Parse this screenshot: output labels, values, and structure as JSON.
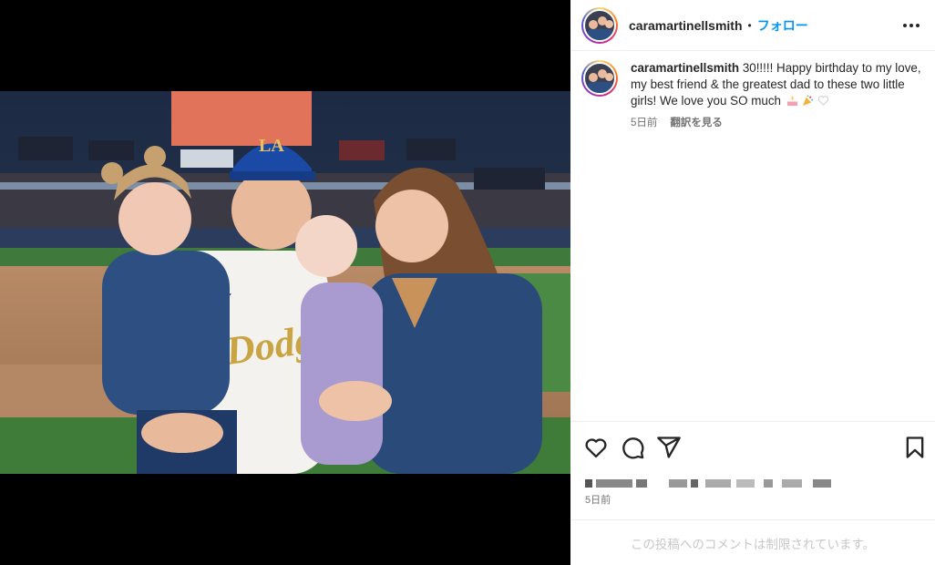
{
  "post": {
    "username": "caramartinellsmith",
    "dot": "•",
    "follow_label": "フォロー",
    "more_icon": "more-horizontal-icon"
  },
  "caption": {
    "username": "caramartinellsmith",
    "text_part1": "30!!!!! Happy birthday to my love, my best friend & the greatest dad to these two little girls! We love you SO much",
    "emojis": [
      "birthday-cake-emoji",
      "party-popper-emoji",
      "white-heart-emoji"
    ],
    "time": "5日前",
    "translate_label": "翻訳を見る"
  },
  "actions": {
    "like_icon": "heart-icon",
    "comment_icon": "comment-icon",
    "share_icon": "share-icon",
    "save_icon": "bookmark-icon"
  },
  "timestamp": "5日前",
  "comments_disabled": "この投稿へのコメントは制限されています。",
  "colors": {
    "follow_blue": "#0095f6",
    "meta_gray": "#737373",
    "disabled_gray": "#c7c7c7"
  }
}
